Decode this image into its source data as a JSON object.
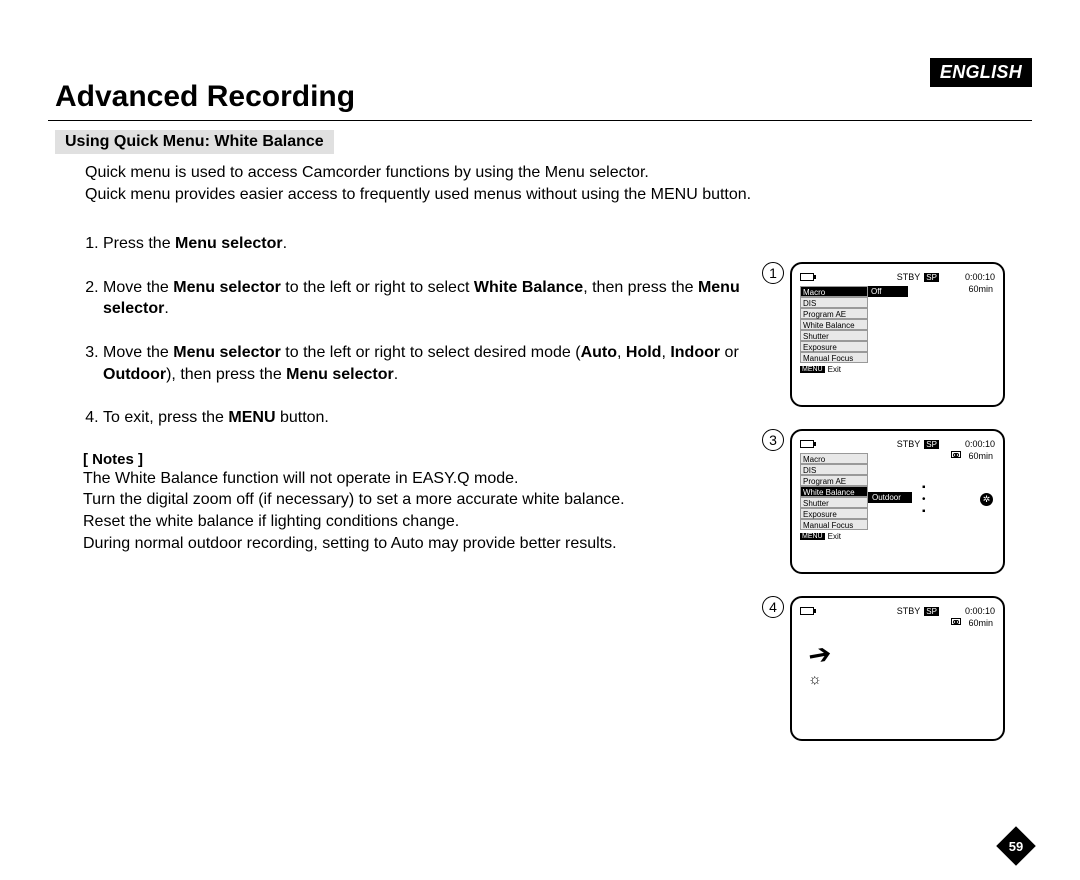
{
  "language_badge": "ENGLISH",
  "page_title": "Advanced Recording",
  "section_heading": "Using Quick Menu: White Balance",
  "intro_line1": "Quick menu is used to access Camcorder functions by using the Menu selector.",
  "intro_line2": "Quick menu provides easier access to frequently used menus without using the MENU button.",
  "step1_a": "Press the ",
  "step1_b": "Menu selector",
  "step1_c": ".",
  "step2_a": "Move the ",
  "step2_b": "Menu selector",
  "step2_c": " to the left or right to select ",
  "step2_d": "White Balance",
  "step2_e": ", then press the ",
  "step2_f": "Menu selector",
  "step2_g": ".",
  "step3_a": "Move the ",
  "step3_b": "Menu selector",
  "step3_c": " to the left or right to select desired mode (",
  "step3_d": "Auto",
  "step3_e": ", ",
  "step3_f": "Hold",
  "step3_g": ", ",
  "step3_h": "Indoor",
  "step3_i": " or ",
  "step3_j": "Outdoor",
  "step3_k": "), then press the ",
  "step3_l": "Menu selector",
  "step3_m": ".",
  "step4_a": "To exit, press the ",
  "step4_b": "MENU",
  "step4_c": " button.",
  "notes_title": "[ Notes ]",
  "note1": "The White Balance function will not operate in EASY.Q mode.",
  "note2": "Turn the digital zoom off (if necessary) to set a more accurate white balance.",
  "note3": "Reset the white balance if lighting conditions change.",
  "note4": "During normal outdoor recording, setting to Auto may provide better results.",
  "lcd": {
    "stby": "STBY",
    "sp": "SP",
    "timecode": "0:00:10",
    "remain": "60min",
    "menu_items": [
      "Macro",
      "DIS",
      "Program AE",
      "White Balance",
      "Shutter",
      "Exposure",
      "Manual Focus"
    ],
    "off_value": "Off",
    "outdoor_value": "Outdoor",
    "menu_badge": "MENU",
    "exit": "Exit"
  },
  "markers": {
    "m1": "1",
    "m3": "3",
    "m4": "4"
  },
  "page_number": "59"
}
